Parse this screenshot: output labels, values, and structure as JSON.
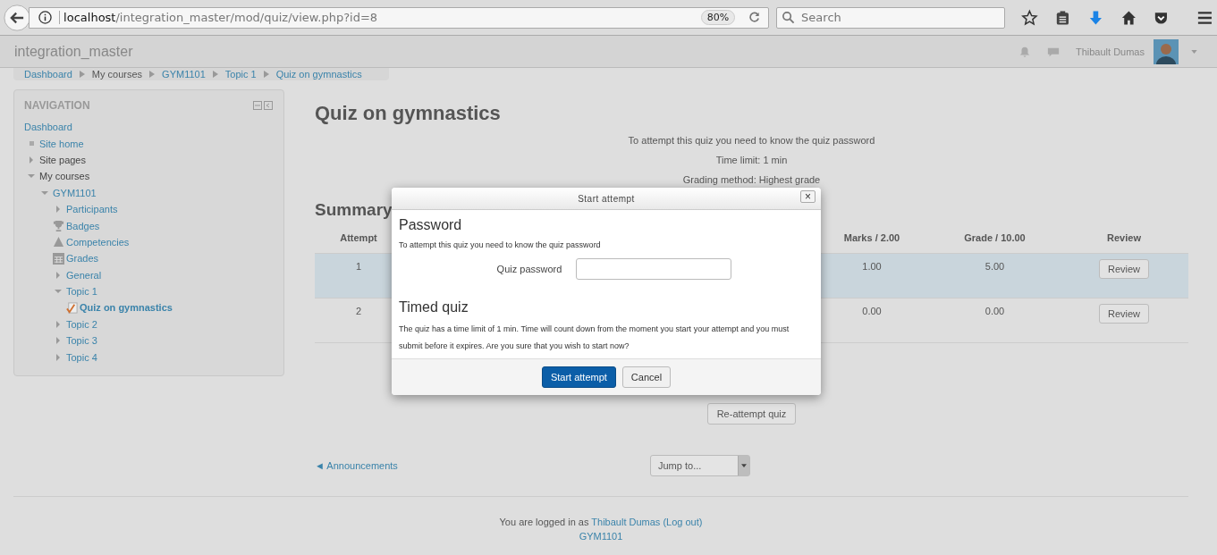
{
  "browser": {
    "url_host": "localhost",
    "url_path": "/integration_master/mod/quiz/view.php?id=8",
    "zoom": "80%",
    "search": {
      "placeholder": "Search"
    }
  },
  "header": {
    "site_name": "integration_master",
    "user_name": "Thibault Dumas"
  },
  "breadcrumb": [
    {
      "label": "Dashboard",
      "link": true
    },
    {
      "label": "My courses",
      "link": false
    },
    {
      "label": "GYM1101",
      "link": true
    },
    {
      "label": "Topic 1",
      "link": true
    },
    {
      "label": "Quiz on gymnastics",
      "link": true
    }
  ],
  "navigation": {
    "title": "NAVIGATION",
    "items": [
      {
        "label": "Dashboard",
        "kind": "plain",
        "link": true,
        "current": false
      },
      {
        "label": "Site home",
        "kind": "bullet",
        "link": true,
        "current": false
      },
      {
        "label": "Site pages",
        "kind": "branch",
        "expanded": false,
        "link": false,
        "current": false
      },
      {
        "label": "My courses",
        "kind": "branch",
        "expanded": true,
        "link": false,
        "current": false,
        "children": [
          {
            "label": "GYM1101",
            "kind": "branch",
            "expanded": true,
            "link": true,
            "current": false,
            "children": [
              {
                "label": "Participants",
                "kind": "branch",
                "expanded": false,
                "link": true,
                "current": false
              },
              {
                "label": "Badges",
                "kind": "trophy",
                "link": true,
                "current": false
              },
              {
                "label": "Competencies",
                "kind": "competency",
                "link": true,
                "current": false
              },
              {
                "label": "Grades",
                "kind": "grades",
                "link": true,
                "current": false
              },
              {
                "label": "General",
                "kind": "branch",
                "expanded": false,
                "link": true,
                "current": false
              },
              {
                "label": "Topic 1",
                "kind": "branch",
                "expanded": true,
                "link": true,
                "current": false,
                "children": [
                  {
                    "label": "Quiz on gymnastics",
                    "kind": "quiz",
                    "link": true,
                    "current": true
                  }
                ]
              },
              {
                "label": "Topic 2",
                "kind": "branch",
                "expanded": false,
                "link": true,
                "current": false
              },
              {
                "label": "Topic 3",
                "kind": "branch",
                "expanded": false,
                "link": true,
                "current": false
              },
              {
                "label": "Topic 4",
                "kind": "branch",
                "expanded": false,
                "link": true,
                "current": false
              }
            ]
          }
        ]
      }
    ]
  },
  "main": {
    "title": "Quiz on gymnastics",
    "info": [
      "To attempt this quiz you need to know the quiz password",
      "Time limit: 1 min",
      "Grading method: Highest grade"
    ],
    "summary_heading": "Summary",
    "table": {
      "columns": [
        "Attempt",
        "Marks / 2.00",
        "Grade / 10.00",
        "Review"
      ],
      "rows": [
        {
          "attempt": "1",
          "marks": "1.00",
          "grade": "5.00",
          "review": "Review",
          "highlighted": true
        },
        {
          "attempt": "2",
          "marks": "0.00",
          "grade": "0.00",
          "review": "Review",
          "highlighted": false
        }
      ]
    },
    "reattempt_button": "Re-attempt quiz",
    "prev_link": "◄ Announcements",
    "jump_select": "Jump to..."
  },
  "footer": {
    "logged_in_prefix": "You are logged in as",
    "user_name": "Thibault Dumas",
    "logout": "(Log out)",
    "course": "GYM1101"
  },
  "dialog": {
    "title": "Start attempt",
    "close": "×",
    "password_heading": "Password",
    "password_text": "To attempt this quiz you need to know the quiz password",
    "password_label": "Quiz password",
    "timed_heading": "Timed quiz",
    "timed_text": "The quiz has a time limit of 1 min. Time will count down from the moment you start your attempt and you must submit before it expires. Are you sure that you wish to start now?",
    "buttons": [
      {
        "label": "Start attempt",
        "kind": "primary"
      },
      {
        "label": "Cancel",
        "kind": "secondary"
      }
    ]
  }
}
